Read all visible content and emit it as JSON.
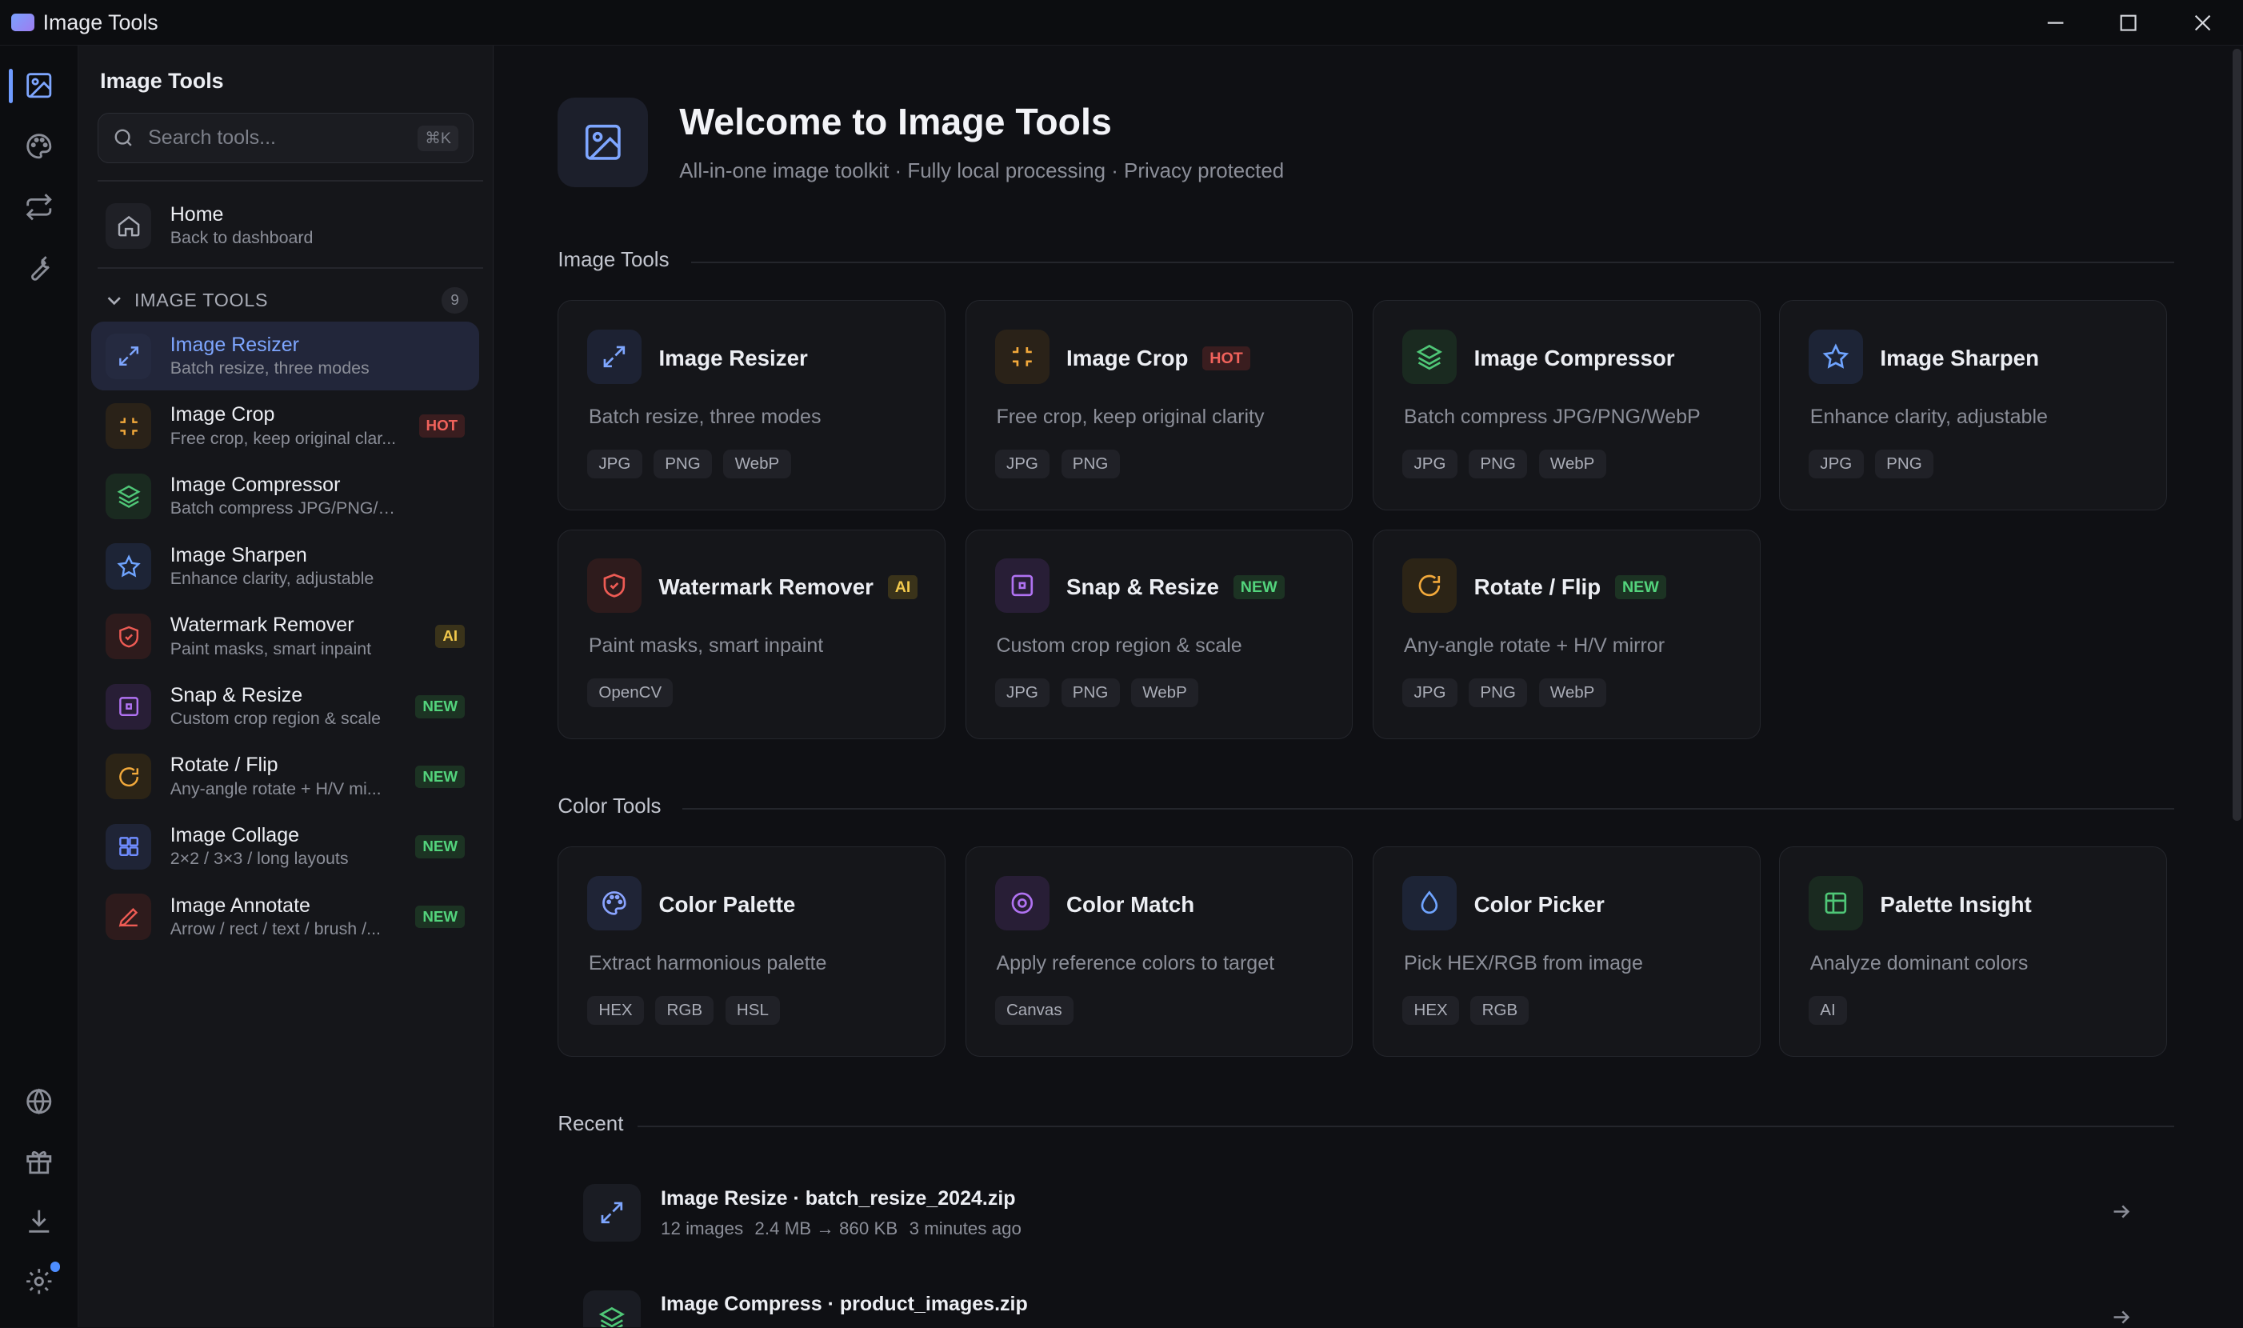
{
  "window": {
    "title": "Image Tools"
  },
  "sidebar": {
    "title": "Image Tools",
    "search": {
      "placeholder": "Search tools...",
      "shortcut": "⌘K"
    },
    "home": {
      "title": "Home",
      "subtitle": "Back to dashboard"
    },
    "section": {
      "label": "IMAGE TOOLS",
      "count": "9"
    },
    "items": [
      {
        "title": "Image Resizer",
        "subtitle": "Batch resize, three modes",
        "badge": "",
        "icon": "resize-icon",
        "active": true
      },
      {
        "title": "Image Crop",
        "subtitle": "Free crop, keep original clar...",
        "badge": "HOT",
        "icon": "crop-icon"
      },
      {
        "title": "Image Compressor",
        "subtitle": "Batch compress JPG/PNG/WebP",
        "badge": "",
        "icon": "layers-icon"
      },
      {
        "title": "Image Sharpen",
        "subtitle": "Enhance clarity, adjustable",
        "badge": "",
        "icon": "star-icon"
      },
      {
        "title": "Watermark Remover",
        "subtitle": "Paint masks, smart inpaint",
        "badge": "AI",
        "icon": "shield-icon"
      },
      {
        "title": "Snap & Resize",
        "subtitle": "Custom crop region & scale",
        "badge": "NEW",
        "icon": "snap-icon"
      },
      {
        "title": "Rotate / Flip",
        "subtitle": "Any-angle rotate + H/V mi...",
        "badge": "NEW",
        "icon": "rotate-icon"
      },
      {
        "title": "Image Collage",
        "subtitle": "2×2 / 3×3 / long layouts",
        "badge": "NEW",
        "icon": "grid-icon"
      },
      {
        "title": "Image Annotate",
        "subtitle": "Arrow / rect / text / brush /...",
        "badge": "NEW",
        "icon": "pen-icon"
      }
    ]
  },
  "hero": {
    "title": "Welcome to Image Tools",
    "subtitle": "All-in-one image toolkit · Fully local processing · Privacy protected"
  },
  "sections": {
    "image_tools": "Image Tools",
    "color_tools": "Color Tools",
    "recent": "Recent"
  },
  "image_cards": [
    {
      "title": "Image Resizer",
      "desc": "Batch resize, three modes",
      "badge": "",
      "tags": [
        "JPG",
        "PNG",
        "WebP"
      ],
      "icon": "resize-icon"
    },
    {
      "title": "Image Crop",
      "desc": "Free crop, keep original clarity",
      "badge": "HOT",
      "tags": [
        "JPG",
        "PNG"
      ],
      "icon": "crop-icon"
    },
    {
      "title": "Image Compressor",
      "desc": "Batch compress JPG/PNG/WebP",
      "badge": "",
      "tags": [
        "JPG",
        "PNG",
        "WebP"
      ],
      "icon": "layers-icon"
    },
    {
      "title": "Image Sharpen",
      "desc": "Enhance clarity, adjustable",
      "badge": "",
      "tags": [
        "JPG",
        "PNG"
      ],
      "icon": "star-icon"
    },
    {
      "title": "Watermark Remover",
      "desc": "Paint masks, smart inpaint",
      "badge": "AI",
      "tags": [
        "OpenCV"
      ],
      "icon": "shield-icon"
    },
    {
      "title": "Snap & Resize",
      "desc": "Custom crop region & scale",
      "badge": "NEW",
      "tags": [
        "JPG",
        "PNG",
        "WebP"
      ],
      "icon": "snap-icon"
    },
    {
      "title": "Rotate / Flip",
      "desc": "Any-angle rotate + H/V mirror",
      "badge": "NEW",
      "tags": [
        "JPG",
        "PNG",
        "WebP"
      ],
      "icon": "rotate-icon"
    }
  ],
  "color_cards": [
    {
      "title": "Color Palette",
      "desc": "Extract harmonious palette",
      "tags": [
        "HEX",
        "RGB",
        "HSL"
      ],
      "icon": "palette-icon"
    },
    {
      "title": "Color Match",
      "desc": "Apply reference colors to target",
      "tags": [
        "Canvas"
      ],
      "icon": "target-icon"
    },
    {
      "title": "Color Picker",
      "desc": "Pick HEX/RGB from image",
      "tags": [
        "HEX",
        "RGB"
      ],
      "icon": "droplet-icon"
    },
    {
      "title": "Palette Insight",
      "desc": "Analyze dominant colors",
      "tags": [
        "AI"
      ],
      "icon": "table-icon"
    }
  ],
  "recent": [
    {
      "title": "Image Resize · batch_resize_2024.zip",
      "meta": [
        "12 images",
        "2.4 MB → 860 KB",
        "3 minutes ago"
      ],
      "icon": "resize-icon"
    },
    {
      "title": "Image Compress · product_images.zip",
      "meta": [],
      "icon": "layers-icon"
    }
  ],
  "colors": {
    "background": "#0f1014",
    "sidebar": "#15161a",
    "accent": "#6f9bff",
    "hot": "#f0625b",
    "ai": "#f2c94c",
    "new": "#53d37c"
  }
}
